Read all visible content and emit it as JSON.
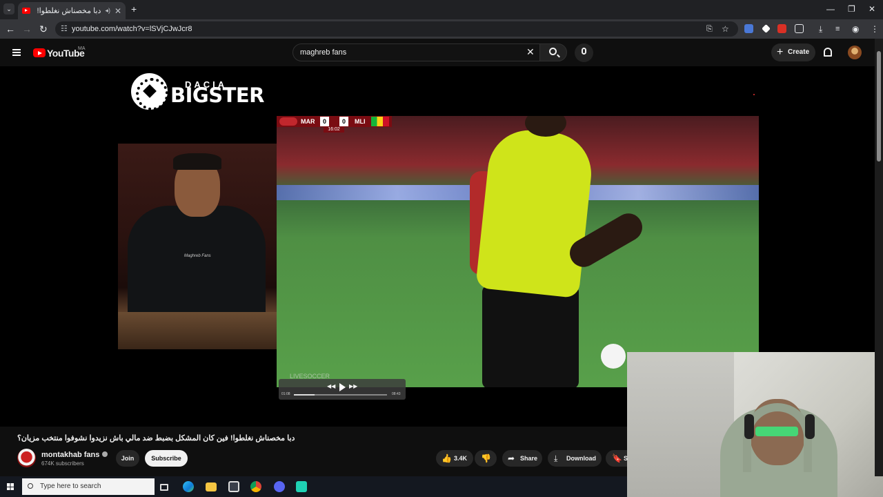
{
  "browser": {
    "tab_title": "دبا مخصناش نغلطوا! فين كا...",
    "tab_close": "✕",
    "new_tab": "+",
    "window_controls": {
      "minimize": "—",
      "restore": "❐",
      "close": "✕"
    },
    "url": "youtube.com/watch?v=lSVjCJwJcr8",
    "nav": {
      "back": "←",
      "forward": "→",
      "reload": "↻"
    },
    "toolbar_icons": [
      "install-icon",
      "bookmark-star-icon",
      "translate-icon",
      "extension-icon",
      "download-icon",
      "tab-search-icon",
      "profile-icon",
      "menu-icon"
    ]
  },
  "youtube": {
    "logo_text": "YouTube",
    "region": "MA",
    "search_value": "maghreb fans",
    "search_clear": "✕",
    "create_label": "Create",
    "create_plus": "+"
  },
  "video": {
    "brand_small": "DACIA",
    "brand_big": "BIGSTER",
    "host_shirt_text": "Maghreb Fans",
    "scoreboard": {
      "team1": "MAR",
      "score1": "0",
      "score2": "0",
      "team2": "MLI",
      "clock": "16:02"
    },
    "overlay_watermark": "LIVESOCCER",
    "mini_time_left": "01:08",
    "mini_time_right": "08:43",
    "title": "دبا مخصناش نغلطوا! فين كان المشكل بضبط ضد مالي باش نزيدوا نشوفوا منتخب مزيان؟",
    "channel_name": "montakhab fans",
    "subscribers": "674K subscribers",
    "join_label": "Join",
    "subscribe_label": "Subscribe",
    "likes": "3.4K",
    "share_label": "Share",
    "download_label": "Download",
    "save_label": "S"
  },
  "taskbar": {
    "search_placeholder": "Type here to search",
    "apps": [
      "task-view-icon",
      "edge-icon",
      "file-explorer-icon",
      "store-icon",
      "chrome-icon",
      "discord-icon",
      "app-icon"
    ]
  }
}
